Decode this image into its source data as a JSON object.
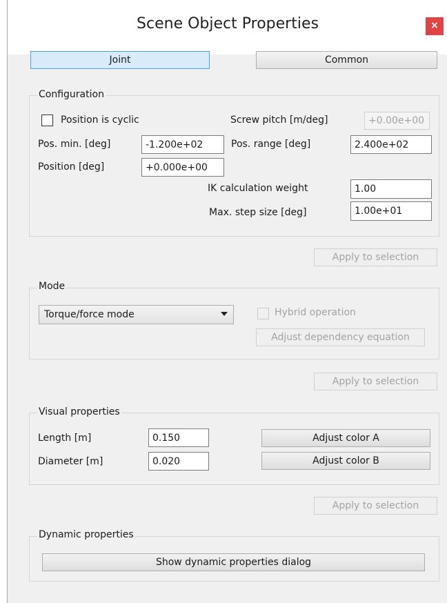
{
  "window": {
    "title": "Scene Object Properties",
    "close_glyph": "×"
  },
  "tabs": {
    "joint": "Joint",
    "common": "Common"
  },
  "configuration": {
    "legend": "Configuration",
    "cyclic_label": "Position is cyclic",
    "screw_pitch_label": "Screw pitch [m/deg]",
    "screw_pitch_value": "+0.00e+00",
    "pos_min_label": "Pos. min. [deg]",
    "pos_min_value": "-1.200e+02",
    "pos_range_label": "Pos. range [deg]",
    "pos_range_value": "2.400e+02",
    "position_label": "Position [deg]",
    "position_value": "+0.000e+00",
    "ik_weight_label": "IK calculation weight",
    "ik_weight_value": "1.00",
    "max_step_label": "Max. step size [deg]",
    "max_step_value": "1.00e+01",
    "apply_label": "Apply to selection"
  },
  "mode": {
    "legend": "Mode",
    "selected": "Torque/force mode",
    "hybrid_label": "Hybrid operation",
    "dependency_button": "Adjust dependency equation",
    "apply_label": "Apply to selection"
  },
  "visual": {
    "legend": "Visual properties",
    "length_label": "Length [m]",
    "length_value": "0.150",
    "diameter_label": "Diameter [m]",
    "diameter_value": "0.020",
    "color_a_button": "Adjust color A",
    "color_b_button": "Adjust color B",
    "apply_label": "Apply to selection"
  },
  "dynamic": {
    "legend": "Dynamic properties",
    "dialog_button": "Show dynamic properties dialog"
  }
}
